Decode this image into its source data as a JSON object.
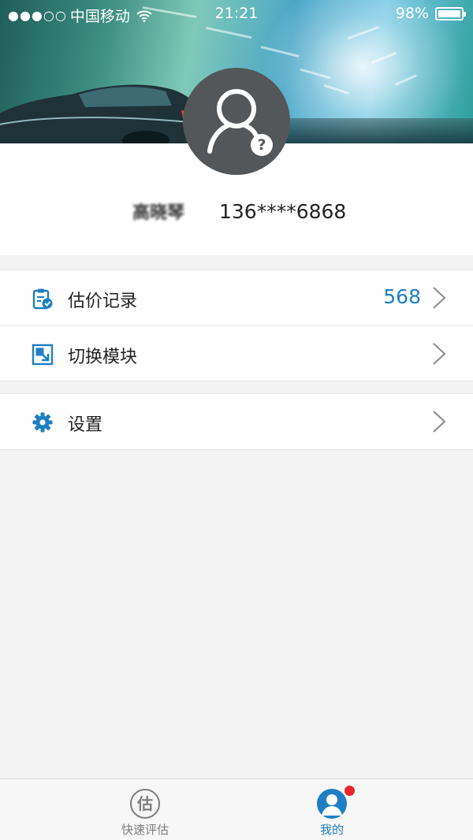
{
  "status_bar": {
    "signal_dots": "●●●○○",
    "carrier": "中国移动",
    "time": "21:21",
    "battery": "98%",
    "wifi_icon": "wifi-icon",
    "battery_icon": "battery-icon"
  },
  "profile": {
    "avatar_icon": "user-avatar-icon",
    "help_badge": "?",
    "username": "高晓琴",
    "phone": "136****6868"
  },
  "menu": {
    "items": [
      {
        "label": "估价记录",
        "count": "568",
        "icon": "clipboard-check-icon"
      },
      {
        "label": "切换模块",
        "icon": "switch-module-icon"
      }
    ],
    "settings": {
      "label": "设置",
      "icon": "gear-icon"
    }
  },
  "tabbar": {
    "tabs": [
      {
        "label": "快速评估",
        "icon_text": "估",
        "active": false
      },
      {
        "label": "我的",
        "active": true
      }
    ]
  },
  "colors": {
    "accent": "#1e7fc4",
    "avatar_bg": "#545759",
    "notify": "#e8262b",
    "page_bg": "#f3f3f3"
  }
}
